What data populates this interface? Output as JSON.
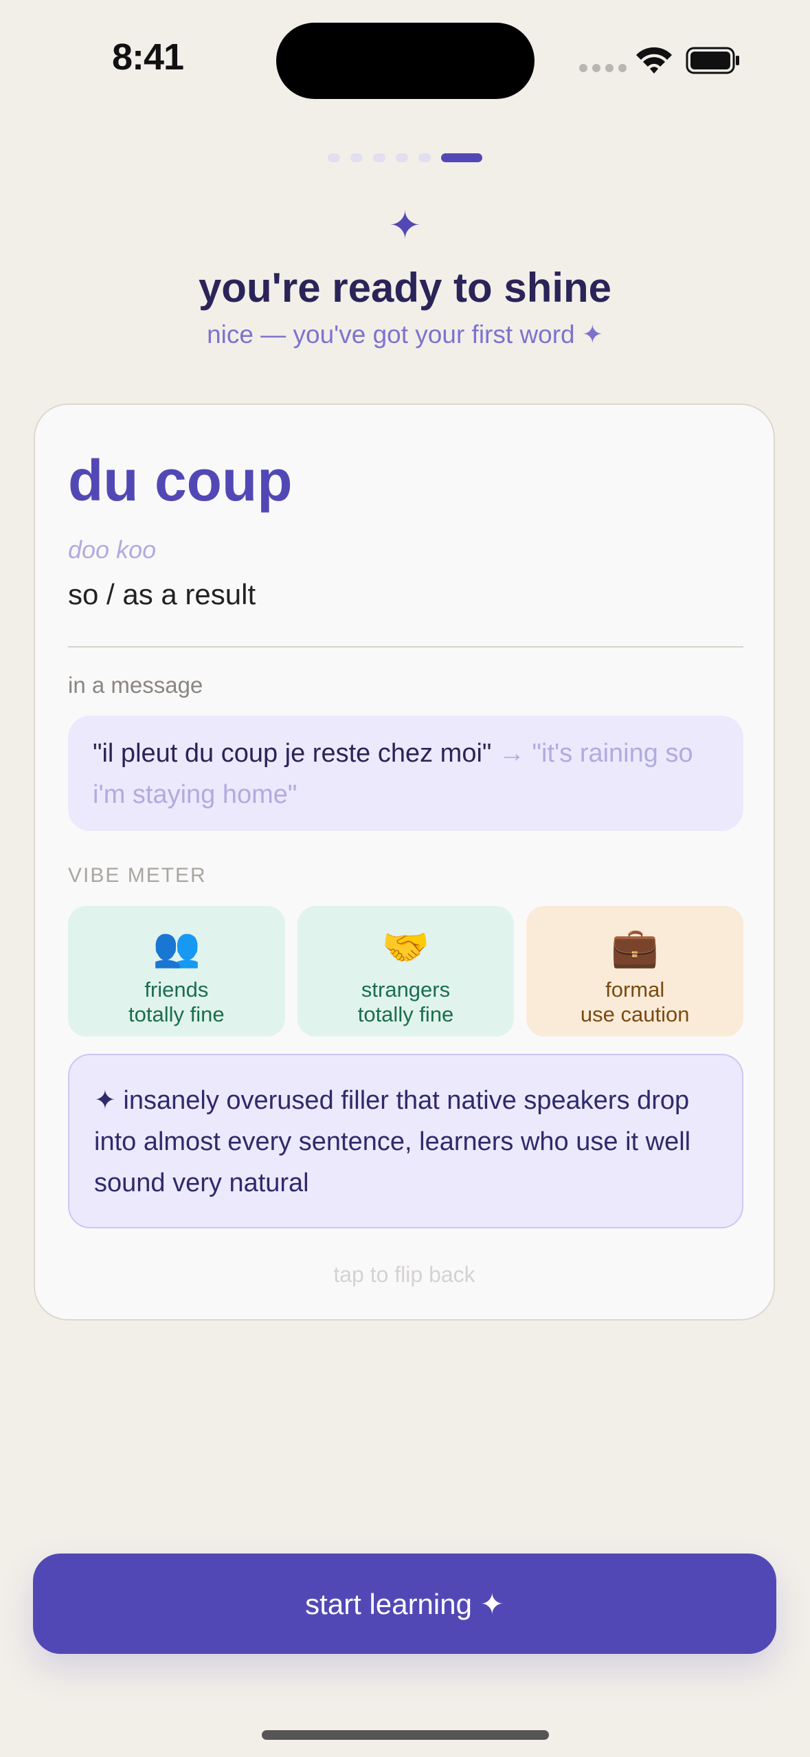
{
  "status_bar": {
    "time": "8:41"
  },
  "progress": {
    "total_steps": 6,
    "current_step": 6
  },
  "header": {
    "sparkle": "✦",
    "title": "you're ready to shine",
    "subtitle": "nice — you've got your first word ✦"
  },
  "card": {
    "word": "du coup",
    "pronunciation": "doo koo",
    "meaning": "so / as a result",
    "message_label": "in a message",
    "example": {
      "text": "\"il pleut du coup je reste chez moi\"",
      "arrow": "→",
      "translation": "\"it's raining so i'm staying home\""
    },
    "vibe_label": "VIBE METER",
    "vibes": [
      {
        "icon": "people-icon",
        "emoji": "👥",
        "who": "friends",
        "how": "totally fine",
        "color": "#e1f3ed"
      },
      {
        "icon": "handshake-icon",
        "emoji": "🤝",
        "who": "strangers",
        "how": "totally fine",
        "color": "#e1f3ed"
      },
      {
        "icon": "briefcase-icon",
        "emoji": "💼",
        "who": "formal",
        "how": "use caution",
        "color": "#faebd9"
      }
    ],
    "note": "✦ insanely overused filler that native speakers drop into almost every sentence, learners who use it well sound very natural",
    "flip_hint": "tap to flip back"
  },
  "cta": {
    "label": "start learning ✦"
  },
  "colors": {
    "accent": "#5248b5",
    "background": "#f2efe9"
  }
}
